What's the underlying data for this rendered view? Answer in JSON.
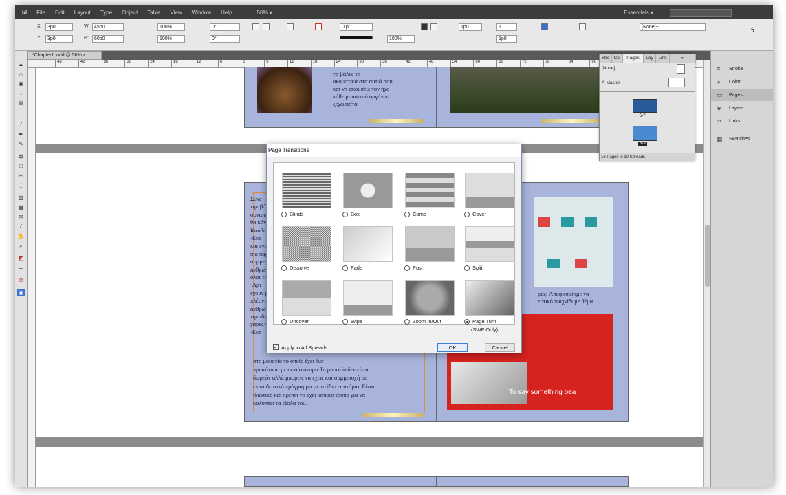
{
  "menubar": [
    "File",
    "Edit",
    "Layout",
    "Type",
    "Object",
    "Table",
    "View",
    "Window",
    "Help",
    "50% ▾"
  ],
  "workspace": "Essentials ▾",
  "control": {
    "x_label": "X:",
    "x": "3p0",
    "y_label": "Y:",
    "y": "3p0",
    "w_label": "W:",
    "w": "45p0",
    "h_label": "H:",
    "h": "60p0",
    "scale1": "100%",
    "scale2": "100%",
    "angle": "0°",
    "shear": "0°",
    "stroke": "0 pt",
    "opacity": "100%",
    "columns": "1p0",
    "gutter": "1",
    "gutter2": "1p0",
    "style": "[None]+"
  },
  "doc_tab": "*Chapter1.indd @ 50% ×",
  "ruler_ticks": [
    "48",
    "42",
    "36",
    "30",
    "24",
    "18",
    "12",
    "6",
    "0",
    "6",
    "12",
    "18",
    "24",
    "30",
    "36",
    "42",
    "48",
    "54",
    "60",
    "66",
    "72",
    "78",
    "84",
    "90",
    "96"
  ],
  "pages_panel": {
    "tabs": [
      "Strc",
      "Col",
      "Pages",
      "Lay",
      "Link",
      "»"
    ],
    "none": "[None]",
    "master": "A-Master",
    "spread1": "6-7",
    "spread2": "8-9",
    "footer": "16 Pages in 10 Spreads"
  },
  "dock": [
    "Stroke",
    "Color",
    "Pages",
    "Layers",
    "Links",
    "Swatches"
  ],
  "greek_top": [
    "να βάλες τα",
    "ακουστικά στα αυτιά σου",
    "και να ακούσεις τον ήχο",
    "κάθε μουσικού οργάνου",
    "ξεχωριστά."
  ],
  "greek_left": [
    "Συνε",
    "την βόλτ",
    "συναισθ",
    "θα κάνε",
    "Κουβεν",
    "-Εκτ",
    "και εγώ",
    "πιο παρ",
    "συμμετ",
    "άνθρωπ",
    "όλοι τα",
    "-Αρι",
    "έχουν μ",
    "πλέον έ",
    "ανθρώπ",
    "την ιδιώ",
    "χαρές τι",
    "-Εκτ"
  ],
  "greek_bottom": [
    "στο μουσείο το οποίο έχει ένα",
    "πρωτότυπο  με ωραίο όνομα.Το μουσείο δεν είναι",
    "δωρεάν αλλά μπορείς να έχεις και συμμετοχή σε",
    "εκπαιδευτικό πρόγραμμα με το ίδιο εισιτήριο. Είναι",
    "ιδιωτικό και πρέπει να έχει κάποιο τρόπο για να",
    "καλύπτει τα έξοδα του."
  ],
  "greek_right": [
    "ρας: Αποφασίσαμε να",
    "ευτικό παιχνίδι με θέμα"
  ],
  "photo_caption": "To say something bea",
  "dialog": {
    "title": "Page Transitions",
    "options": [
      {
        "label": "Blinds",
        "selected": false
      },
      {
        "label": "Box",
        "selected": false
      },
      {
        "label": "Comb",
        "selected": false
      },
      {
        "label": "Cover",
        "selected": false
      },
      {
        "label": "Dissolve",
        "selected": false
      },
      {
        "label": "Fade",
        "selected": false
      },
      {
        "label": "Push",
        "selected": false
      },
      {
        "label": "Split",
        "selected": false
      },
      {
        "label": "Uncover",
        "selected": false
      },
      {
        "label": "Wipe",
        "selected": false
      },
      {
        "label": "Zoom In/Out",
        "selected": false
      },
      {
        "label": "Page Turn",
        "sublabel": "(SWF Only)",
        "selected": true
      }
    ],
    "apply_label": "Apply to All Spreads",
    "apply_checked": true,
    "ok_label": "OK",
    "cancel_label": "Cancel"
  }
}
